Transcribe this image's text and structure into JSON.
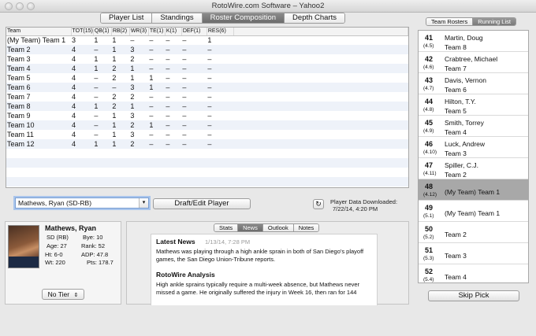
{
  "window": {
    "title": "RotoWire.com Software – Yahoo2"
  },
  "top_tabs": [
    {
      "label": "Player List",
      "active": false
    },
    {
      "label": "Standings",
      "active": false
    },
    {
      "label": "Roster Composition",
      "active": true
    },
    {
      "label": "Depth Charts",
      "active": false
    }
  ],
  "grid": {
    "columns": [
      "Team",
      "TOT(15)",
      "QB(1)",
      "RB(2)",
      "WR(3)",
      "TE(1)",
      "K(1)",
      "DEF(1)",
      "RES(6)"
    ],
    "rows": [
      [
        "(My Team) Team 1",
        "3",
        "1",
        "1",
        "–",
        "–",
        "–",
        "–",
        "1"
      ],
      [
        "Team 2",
        "4",
        "–",
        "1",
        "3",
        "–",
        "–",
        "–",
        "–"
      ],
      [
        "Team 3",
        "4",
        "1",
        "1",
        "2",
        "–",
        "–",
        "–",
        "–"
      ],
      [
        "Team 4",
        "4",
        "1",
        "2",
        "1",
        "–",
        "–",
        "–",
        "–"
      ],
      [
        "Team 5",
        "4",
        "–",
        "2",
        "1",
        "1",
        "–",
        "–",
        "–"
      ],
      [
        "Team 6",
        "4",
        "–",
        "–",
        "3",
        "1",
        "–",
        "–",
        "–"
      ],
      [
        "Team 7",
        "4",
        "–",
        "2",
        "2",
        "–",
        "–",
        "–",
        "–"
      ],
      [
        "Team 8",
        "4",
        "1",
        "2",
        "1",
        "–",
        "–",
        "–",
        "–"
      ],
      [
        "Team 9",
        "4",
        "–",
        "1",
        "3",
        "–",
        "–",
        "–",
        "–"
      ],
      [
        "Team 10",
        "4",
        "–",
        "1",
        "2",
        "1",
        "–",
        "–",
        "–"
      ],
      [
        "Team 11",
        "4",
        "–",
        "1",
        "3",
        "–",
        "–",
        "–",
        "–"
      ],
      [
        "Team 12",
        "4",
        "1",
        "1",
        "2",
        "–",
        "–",
        "–",
        "–"
      ]
    ],
    "empty_rows": 6
  },
  "controls": {
    "player_select": "Mathews, Ryan (SD-RB)",
    "draft_button": "Draft/Edit Player",
    "refresh_icon": "refresh-icon",
    "download_label": "Player Data Downloaded:",
    "download_time": "7/22/14, 4:20 PM"
  },
  "player": {
    "name": "Mathews, Ryan",
    "team_pos": "SD (RB)",
    "bye": "Bye: 10",
    "age": "Age: 27",
    "rank": "Rank: 52",
    "height": "Ht: 6-0",
    "adp": "ADP: 47.8",
    "weight": "Wt: 220",
    "pts": "Pts: 178.7",
    "tier": "No Tier"
  },
  "news": {
    "tabs": [
      {
        "label": "Stats",
        "active": false
      },
      {
        "label": "News",
        "active": true
      },
      {
        "label": "Outlook",
        "active": false
      },
      {
        "label": "Notes",
        "active": false
      }
    ],
    "heading": "Latest News",
    "date": "1/13/14, 7:28 PM",
    "body": "Mathews was playing through a high ankle sprain in both of San Diego's playoff games, the San Diego Union-Tribune reports.",
    "analysis_heading": "RotoWire Analysis",
    "analysis": "High ankle sprains typically require a multi-week absence, but Mathews never missed a game. He originally suffered the injury in Week 16, then ran for 144"
  },
  "right_tabs": [
    {
      "label": "Team Rosters",
      "active": false
    },
    {
      "label": "Running List",
      "active": true
    }
  ],
  "running_list": [
    {
      "pick": "41",
      "pos": "(4.5)",
      "player": "Martin, Doug",
      "team": "Team 8",
      "selected": false
    },
    {
      "pick": "42",
      "pos": "(4.6)",
      "player": "Crabtree, Michael",
      "team": "Team 7",
      "selected": false
    },
    {
      "pick": "43",
      "pos": "(4.7)",
      "player": "Davis, Vernon",
      "team": "Team 6",
      "selected": false
    },
    {
      "pick": "44",
      "pos": "(4.8)",
      "player": "Hilton, T.Y.",
      "team": "Team 5",
      "selected": false
    },
    {
      "pick": "45",
      "pos": "(4.9)",
      "player": "Smith, Torrey",
      "team": "Team 4",
      "selected": false
    },
    {
      "pick": "46",
      "pos": "(4.10)",
      "player": "Luck, Andrew",
      "team": "Team 3",
      "selected": false
    },
    {
      "pick": "47",
      "pos": "(4.11)",
      "player": "Spiller, C.J.",
      "team": "Team 2",
      "selected": false
    },
    {
      "pick": "48",
      "pos": "(4.12)",
      "player": "",
      "team": "(My Team) Team 1",
      "selected": true
    },
    {
      "pick": "49",
      "pos": "(5.1)",
      "player": "",
      "team": "(My Team) Team 1",
      "selected": false
    },
    {
      "pick": "50",
      "pos": "(5.2)",
      "player": "",
      "team": "Team 2",
      "selected": false
    },
    {
      "pick": "51",
      "pos": "(5.3)",
      "player": "",
      "team": "Team 3",
      "selected": false
    },
    {
      "pick": "52",
      "pos": "(5.4)",
      "player": "",
      "team": "Team 4",
      "selected": false
    }
  ],
  "skip_button": "Skip Pick"
}
